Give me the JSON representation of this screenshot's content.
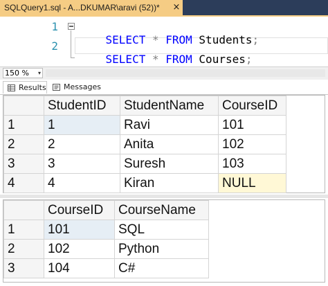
{
  "tab": {
    "title": "SQLQuery1.sql - A...DKUMAR\\aravi (52))*",
    "close": "×"
  },
  "editor": {
    "lines": [
      {
        "num": "1",
        "kw1": "SELECT",
        "op": "*",
        "kw2": "FROM",
        "ident": "Students",
        "end": ";"
      },
      {
        "num": "2",
        "kw1": "SELECT",
        "op": "*",
        "kw2": "FROM",
        "ident": "Courses",
        "end": ";"
      }
    ]
  },
  "zoom": {
    "value": "150 %",
    "arrow": "▾"
  },
  "result_tabs": [
    {
      "label": "Results"
    },
    {
      "label": "Messages"
    }
  ],
  "students": {
    "columns": [
      "StudentID",
      "StudentName",
      "CourseID"
    ],
    "rows": [
      {
        "n": "1",
        "id": "1",
        "name": "Ravi",
        "course": "101"
      },
      {
        "n": "2",
        "id": "2",
        "name": "Anita",
        "course": "102"
      },
      {
        "n": "3",
        "id": "3",
        "name": "Suresh",
        "course": "103"
      },
      {
        "n": "4",
        "id": "4",
        "name": "Kiran",
        "course": "NULL"
      }
    ]
  },
  "courses": {
    "columns": [
      "CourseID",
      "CourseName"
    ],
    "rows": [
      {
        "n": "1",
        "id": "101",
        "name": "SQL"
      },
      {
        "n": "2",
        "id": "102",
        "name": "Python"
      },
      {
        "n": "3",
        "id": "104",
        "name": "C#"
      }
    ]
  },
  "colors": {
    "tab_active": "#f5cc84",
    "keyword": "#0000ff",
    "line_number": "#2b91af",
    "null_cell": "#fff8d6"
  }
}
